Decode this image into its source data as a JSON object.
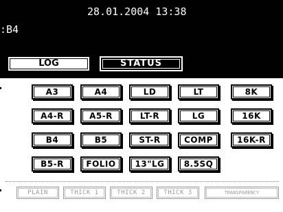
{
  "header": {
    "datetime": "28.01.2004 13:38",
    "paper_size_status": ":B4"
  },
  "tabs": {
    "log": "LOG",
    "status": "STATUS"
  },
  "paper_sizes": {
    "a3": "A3",
    "a4": "A4",
    "ld": "LD",
    "lt": "LT",
    "8k": "8K",
    "a4r": "A4-R",
    "a5r": "A5-R",
    "ltr": "LT-R",
    "lg": "LG",
    "16k": "16K",
    "b4": "B4",
    "b5": "B5",
    "str": "ST-R",
    "comp": "COMP",
    "16kr": "16K-R",
    "b5r": "B5-R",
    "folio": "FOLIO",
    "13lg": "13\"LG",
    "85sq": "8.5SQ"
  },
  "paper_types": {
    "plain": "PLAIN",
    "thick1": "THICK 1",
    "thick2": "THICK 2",
    "thick3": "THICK 3",
    "transparency": "TRANSPARENCY"
  }
}
